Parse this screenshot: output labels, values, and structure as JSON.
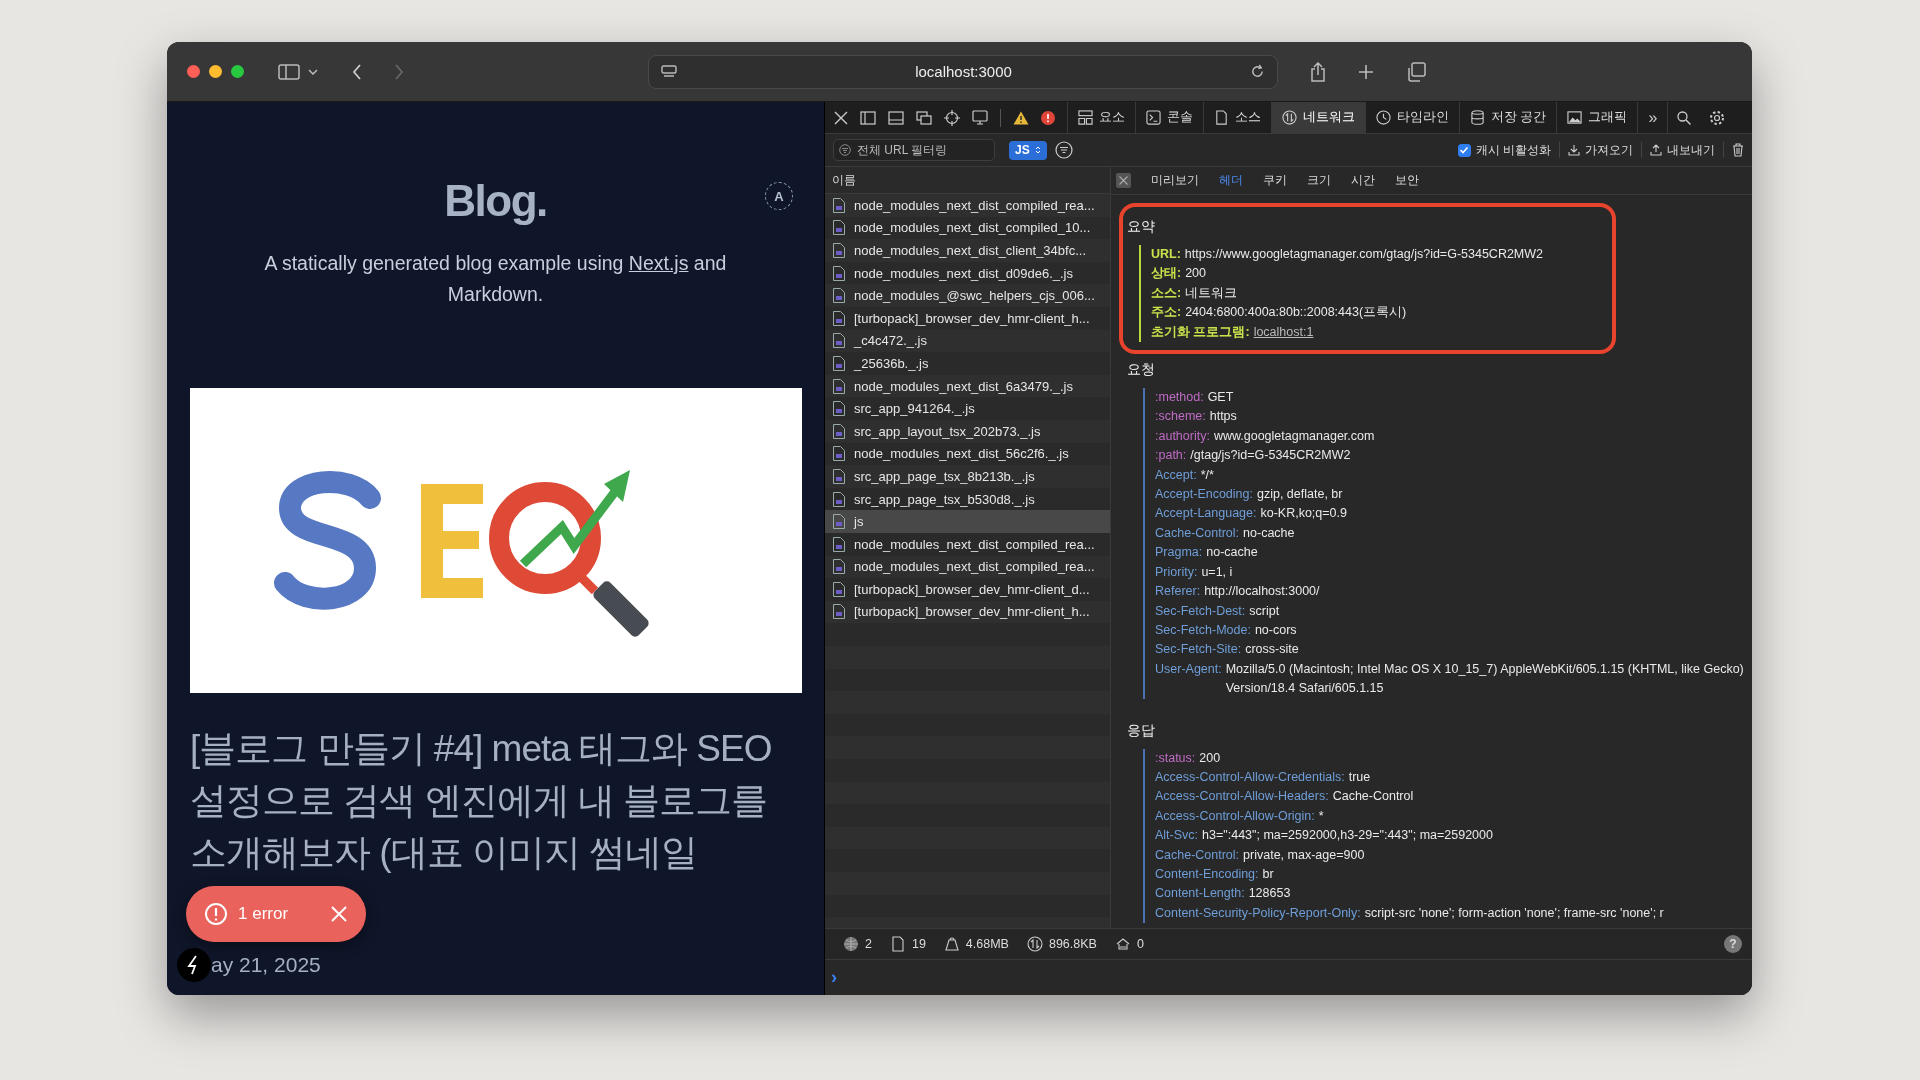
{
  "browser": {
    "url": "localhost:3000"
  },
  "page": {
    "logo": "Blog.",
    "avatar": "A",
    "intro_before": "A statically generated blog example using ",
    "intro_link": "Next.js",
    "intro_after": " and Markdown.",
    "post_title": "[블로그 만들기 #4] meta 태그와 SEO 설정으로 검색 엔진에게 내 블로그를 소개해보자 (대표 이미지 썸네일",
    "date": "ay 21, 2025",
    "error_toast": "1 error"
  },
  "devtools": {
    "tabs": [
      {
        "label": "요소",
        "selected": false
      },
      {
        "label": "콘솔",
        "selected": false
      },
      {
        "label": "소스",
        "selected": false
      },
      {
        "label": "네트워크",
        "selected": true
      },
      {
        "label": "타임라인",
        "selected": false
      },
      {
        "label": "저장 공간",
        "selected": false
      },
      {
        "label": "그래픽",
        "selected": false
      }
    ],
    "more": "»",
    "filter": {
      "placeholder": "전체 URL 필터링",
      "type": "JS",
      "disable_cache": {
        "label": "캐시 비활성화",
        "checked": true
      },
      "import": "가져오기",
      "export": "내보내기"
    },
    "list_header": "이름",
    "requests": [
      {
        "name": "node_modules_next_dist_compiled_rea...",
        "selected": false
      },
      {
        "name": "node_modules_next_dist_compiled_10...",
        "selected": false
      },
      {
        "name": "node_modules_next_dist_client_34bfc...",
        "selected": false
      },
      {
        "name": "node_modules_next_dist_d09de6._.js",
        "selected": false
      },
      {
        "name": "node_modules_@swc_helpers_cjs_006...",
        "selected": false
      },
      {
        "name": "[turbopack]_browser_dev_hmr-client_h...",
        "selected": false
      },
      {
        "name": "_c4c472._.js",
        "selected": false
      },
      {
        "name": "_25636b._.js",
        "selected": false
      },
      {
        "name": "node_modules_next_dist_6a3479._.js",
        "selected": false
      },
      {
        "name": "src_app_941264._.js",
        "selected": false
      },
      {
        "name": "src_app_layout_tsx_202b73._.js",
        "selected": false
      },
      {
        "name": "node_modules_next_dist_56c2f6._.js",
        "selected": false
      },
      {
        "name": "src_app_page_tsx_8b213b._.js",
        "selected": false
      },
      {
        "name": "src_app_page_tsx_b530d8._.js",
        "selected": false
      },
      {
        "name": "js",
        "selected": true
      },
      {
        "name": "node_modules_next_dist_compiled_rea...",
        "selected": false
      },
      {
        "name": "node_modules_next_dist_compiled_rea...",
        "selected": false
      },
      {
        "name": "[turbopack]_browser_dev_hmr-client_d...",
        "selected": false
      },
      {
        "name": "[turbopack]_browser_dev_hmr-client_h...",
        "selected": false
      }
    ],
    "detail_tabs": [
      {
        "label": "미리보기",
        "selected": false
      },
      {
        "label": "헤더",
        "selected": true
      },
      {
        "label": "쿠키",
        "selected": false
      },
      {
        "label": "크기",
        "selected": false
      },
      {
        "label": "시간",
        "selected": false
      },
      {
        "label": "보안",
        "selected": false
      }
    ],
    "sections": [
      {
        "title": "요약",
        "highlighted": true,
        "items": [
          {
            "kind": "summary",
            "key": "URL:",
            "value": "https://www.googletagmanager.com/gtag/js?id=G-5345CR2MW2",
            "link": false
          },
          {
            "kind": "summary",
            "key": "상태:",
            "value": "200",
            "link": false
          },
          {
            "kind": "summary",
            "key": "소스:",
            "value": "네트워크",
            "link": false
          },
          {
            "kind": "summary",
            "key": "주소:",
            "value": "2404:6800:400a:80b::2008:443(프록시)",
            "link": false
          },
          {
            "kind": "summary",
            "key": "초기화 프로그램:",
            "value": "localhost:1",
            "link": true
          }
        ]
      },
      {
        "title": "요청",
        "highlighted": false,
        "items": [
          {
            "kind": "pseudo",
            "key": ":method:",
            "value": "GET"
          },
          {
            "kind": "pseudo",
            "key": ":scheme:",
            "value": "https"
          },
          {
            "kind": "pseudo",
            "key": ":authority:",
            "value": "www.googletagmanager.com"
          },
          {
            "kind": "pseudo",
            "key": ":path:",
            "value": "/gtag/js?id=G-5345CR2MW2"
          },
          {
            "kind": "header",
            "key": "Accept:",
            "value": "*/*"
          },
          {
            "kind": "header",
            "key": "Accept-Encoding:",
            "value": "gzip, deflate, br"
          },
          {
            "kind": "header",
            "key": "Accept-Language:",
            "value": "ko-KR,ko;q=0.9"
          },
          {
            "kind": "header",
            "key": "Cache-Control:",
            "value": "no-cache"
          },
          {
            "kind": "header",
            "key": "Pragma:",
            "value": "no-cache"
          },
          {
            "kind": "header",
            "key": "Priority:",
            "value": "u=1, i"
          },
          {
            "kind": "header",
            "key": "Referer:",
            "value": "http://localhost:3000/"
          },
          {
            "kind": "header",
            "key": "Sec-Fetch-Dest:",
            "value": "script"
          },
          {
            "kind": "header",
            "key": "Sec-Fetch-Mode:",
            "value": "no-cors"
          },
          {
            "kind": "header",
            "key": "Sec-Fetch-Site:",
            "value": "cross-site"
          },
          {
            "kind": "header",
            "key": "User-Agent:",
            "value": "Mozilla/5.0 (Macintosh; Intel Mac OS X 10_15_7) AppleWebKit/605.1.15 (KHTML, like Gecko) Version/18.4 Safari/605.1.15"
          }
        ]
      },
      {
        "title": "응답",
        "highlighted": false,
        "items": [
          {
            "kind": "pseudo",
            "key": ":status:",
            "value": "200"
          },
          {
            "kind": "header",
            "key": "Access-Control-Allow-Credentials:",
            "value": "true"
          },
          {
            "kind": "header",
            "key": "Access-Control-Allow-Headers:",
            "value": "Cache-Control"
          },
          {
            "kind": "header",
            "key": "Access-Control-Allow-Origin:",
            "value": "*"
          },
          {
            "kind": "header",
            "key": "Alt-Svc:",
            "value": "h3=\":443\"; ma=2592000,h3-29=\":443\"; ma=2592000"
          },
          {
            "kind": "header",
            "key": "Cache-Control:",
            "value": "private, max-age=900"
          },
          {
            "kind": "header",
            "key": "Content-Encoding:",
            "value": "br"
          },
          {
            "kind": "header",
            "key": "Content-Length:",
            "value": "128653"
          },
          {
            "kind": "header",
            "key": "Content-Security-Policy-Report-Only:",
            "value": "script-src 'none'; form-action 'none'; frame-src 'none'; r"
          }
        ]
      }
    ],
    "status": [
      {
        "kind": "domains",
        "value": "2"
      },
      {
        "kind": "resources",
        "value": "19"
      },
      {
        "kind": "size",
        "value": "4.68MB"
      },
      {
        "kind": "transferred",
        "value": "896.8KB"
      },
      {
        "kind": "redirects",
        "value": "0"
      }
    ],
    "help": "?",
    "console_prompt": "›"
  }
}
